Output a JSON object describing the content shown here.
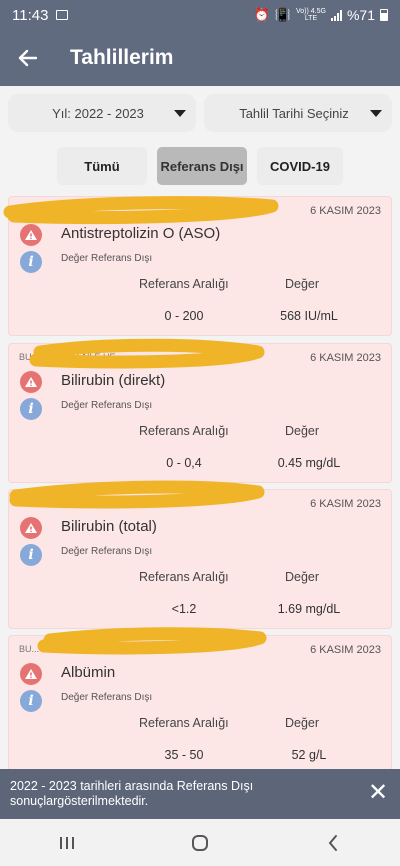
{
  "status_bar": {
    "time": "11:43",
    "network": "Vo)) 4.5G",
    "lte": "LTE",
    "battery": "%71"
  },
  "app_bar": {
    "title": "Tahlillerim",
    "back_icon": "arrow-left-icon"
  },
  "filters": {
    "year_select": "Yıl: 2022 - 2023",
    "date_select": "Tahlil Tarihi Seçiniz"
  },
  "tabs": [
    {
      "label": "Tümü",
      "active": false
    },
    {
      "label": "Referans Dışı",
      "active": true
    },
    {
      "label": "COVID-19",
      "active": false
    }
  ],
  "results": [
    {
      "place": "BU...",
      "date": "6 KASIM 2023",
      "name": "Antistreptolizin O (ASO)",
      "status": "Değer Referans Dışı",
      "ref_header": "Referans Aralığı",
      "val_header": "Değer",
      "ref": "0 - 200",
      "value": "568 IU/mL"
    },
    {
      "place": "BU... 48 NOLU AİLE HE...",
      "date": "6 KASIM 2023",
      "name": "Bilirubin (direkt)",
      "status": "Değer Referans Dışı",
      "ref_header": "Referans Aralığı",
      "val_header": "Değer",
      "ref": "0 - 0,4",
      "value": "0.45 mg/dL"
    },
    {
      "place": "BU... 48 NOLU AİLE HEKİMLİĞİ BİRİM",
      "date": "6 KASIM 2023",
      "name": "Bilirubin (total)",
      "status": "Değer Referans Dışı",
      "ref_header": "Referans Aralığı",
      "val_header": "Değer",
      "ref": "<1.2",
      "value": "1.69 mg/dL"
    },
    {
      "place": "BU... AİLE HEKİMLİĞİ BİRİ",
      "date": "6 KASIM 2023",
      "name": "Albümin",
      "status": "Değer Referans Dışı",
      "ref_header": "Referans Aralığı",
      "val_header": "Değer",
      "ref": "35 - 50",
      "value": "52 g/L"
    }
  ],
  "snackbar": {
    "message": "2022 - 2023 tarihleri arasında Referans Dışı sonuçlargösterilmektedir.",
    "close_icon": "close-icon"
  },
  "colors": {
    "header": "#616b80",
    "card_bg": "#fde6e6",
    "warn": "#e57373",
    "info": "#86a9d9",
    "redaction": "#f0b429"
  }
}
